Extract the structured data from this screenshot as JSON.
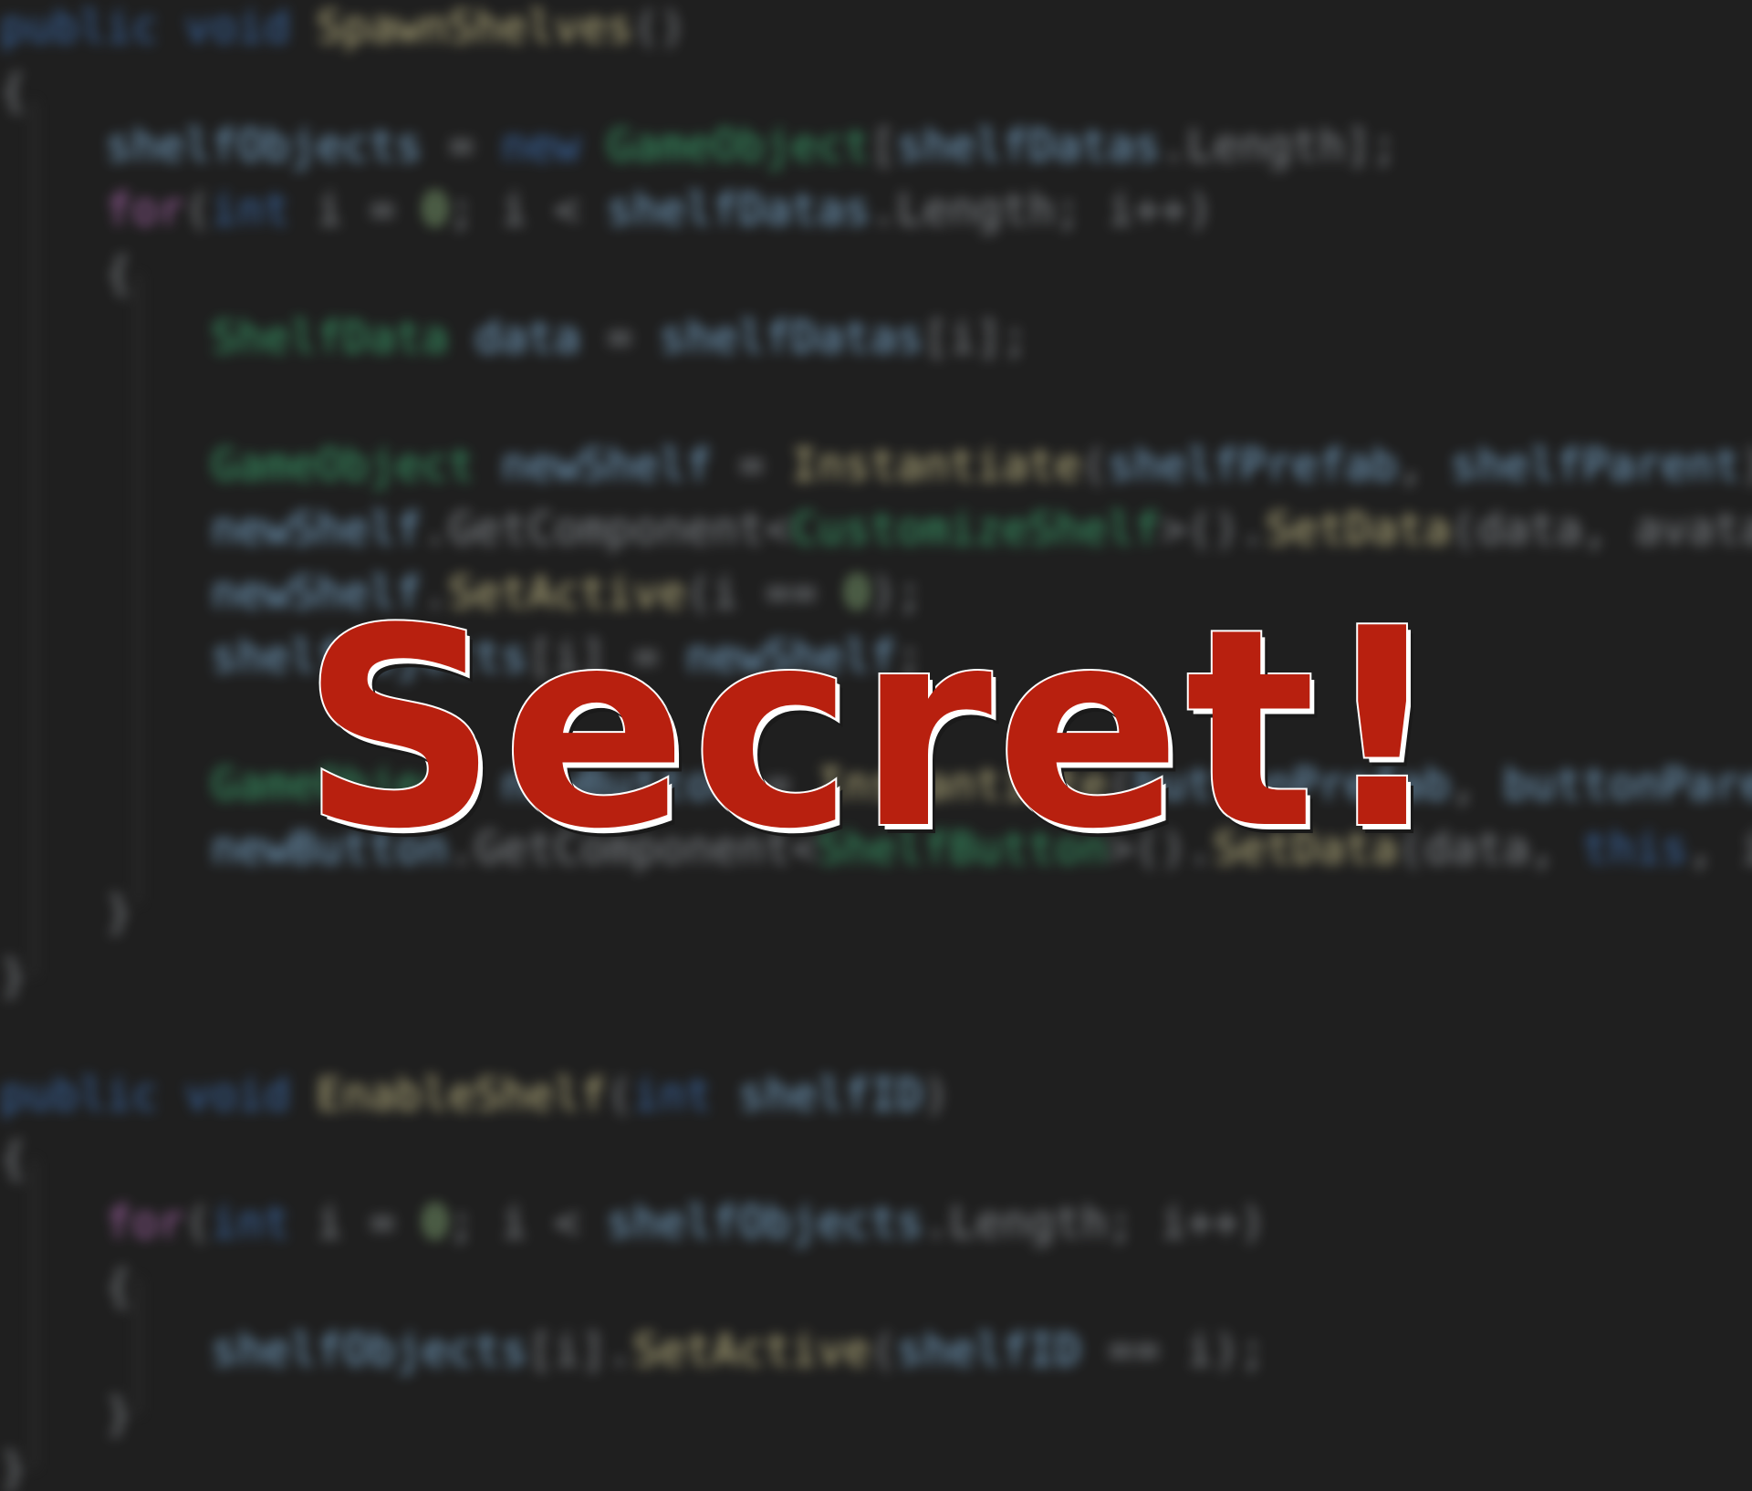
{
  "title": "Secret!",
  "colors": {
    "background": "#1f1f1f",
    "title_fill": "#b8200f",
    "title_outline": "#ffffff",
    "keyword": "#3d6fb0",
    "type": "#3aa46d",
    "method": "#c9c08a",
    "identifier": "#7fb0d6",
    "control": "#b06ab3",
    "number": "#9ccc8a"
  }
}
